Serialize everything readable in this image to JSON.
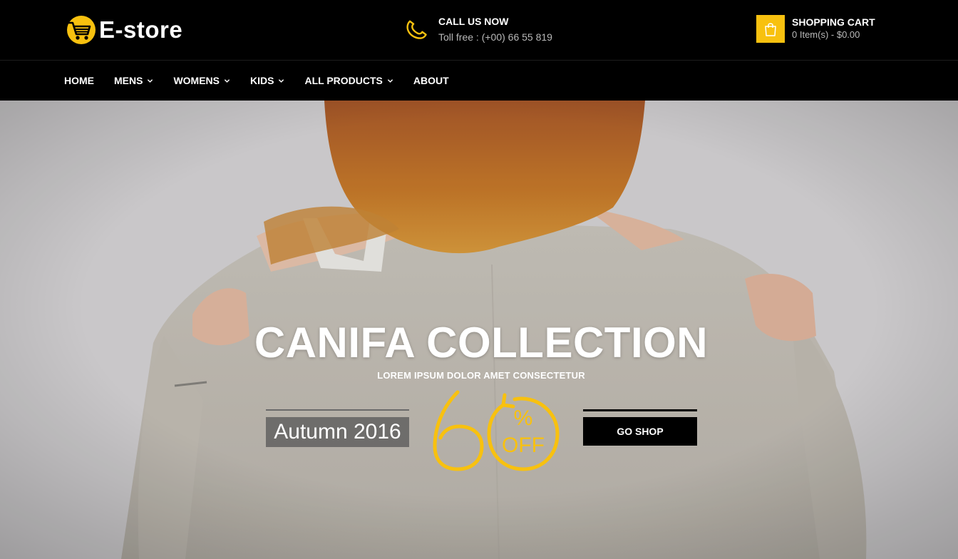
{
  "brand": {
    "name": "E-store"
  },
  "contact": {
    "title": "CALL US NOW",
    "phone": "Toll free : (+00) 66 55 819"
  },
  "cart": {
    "title": "SHOPPING CART",
    "summary": "0 Item(s) - $0.00"
  },
  "nav": {
    "items": [
      {
        "label": "HOME",
        "dropdown": false
      },
      {
        "label": "MENS",
        "dropdown": true
      },
      {
        "label": "WOMENS",
        "dropdown": true
      },
      {
        "label": "KIDS",
        "dropdown": true
      },
      {
        "label": "ALL PRODUCTS",
        "dropdown": true
      },
      {
        "label": "ABOUT",
        "dropdown": false
      }
    ]
  },
  "hero": {
    "title": "CANIFA COLLECTION",
    "subtitle": "LOREM IPSUM DOLOR AMET CONSECTETUR",
    "season": "Autumn 2016",
    "discount": {
      "number": "60",
      "percent": "%",
      "off": "OFF"
    },
    "cta": "GO SHOP"
  },
  "colors": {
    "accent": "#f8c10f",
    "background": "#000000",
    "muted_text": "#b9b9b9"
  },
  "icons": {
    "logo": "shopping-cart-icon",
    "phone": "phone-icon",
    "cart": "shopping-bag-icon",
    "dropdown": "chevron-down-icon"
  }
}
